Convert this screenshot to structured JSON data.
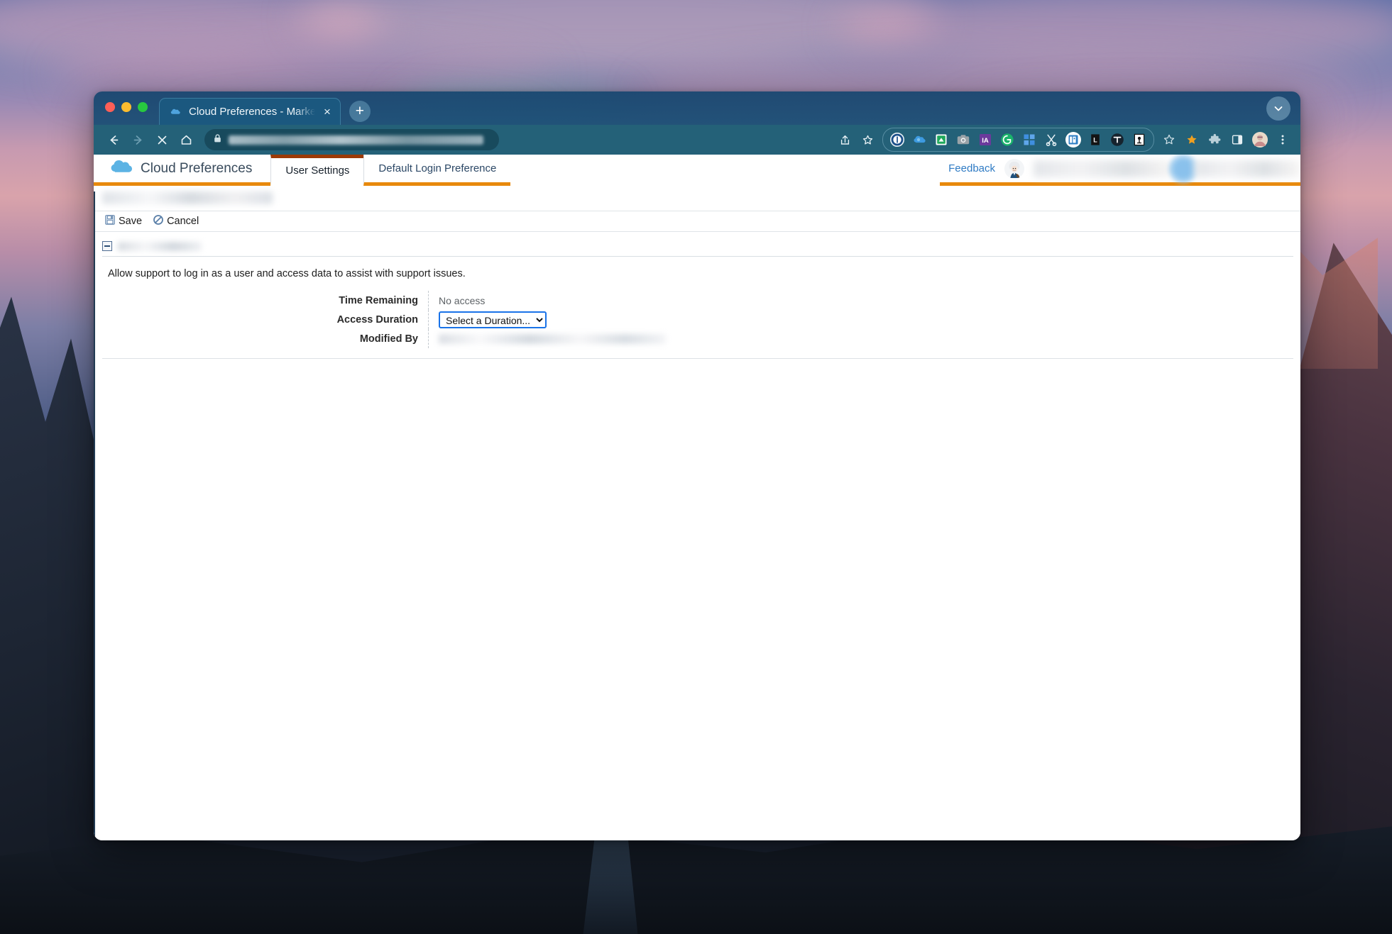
{
  "window": {
    "traffic_lights": [
      "close",
      "minimize",
      "maximize"
    ],
    "tab": {
      "title": "Cloud Preferences - Marketing",
      "favicon": "cloud-favicon",
      "close_label": "×"
    },
    "new_tab_label": "+",
    "tab_list_chevron": "chevron-down-icon"
  },
  "toolbar": {
    "back": "back-arrow",
    "forward": "forward-arrow",
    "stop": "stop-x",
    "home": "home-icon",
    "lock": "lock-icon",
    "url_redacted": true,
    "share": "share-icon",
    "bookmark_star": "star-outline-icon",
    "extensions": [
      {
        "name": "1password-extension",
        "label": "1"
      },
      {
        "name": "cloud-extension",
        "label": ""
      },
      {
        "name": "green-doc-extension",
        "label": ""
      },
      {
        "name": "camera-extension",
        "label": ""
      },
      {
        "name": "ia-extension",
        "label": "IA"
      },
      {
        "name": "grammarly-extension",
        "label": "G"
      },
      {
        "name": "grid-extension",
        "label": ""
      },
      {
        "name": "scissors-extension",
        "label": ""
      },
      {
        "name": "badge-extension",
        "label": ""
      },
      {
        "name": "l-extension",
        "label": "L"
      },
      {
        "name": "t-extension",
        "label": "T"
      },
      {
        "name": "boxed-extension",
        "label": ""
      }
    ],
    "star_outline": "star-outline-icon",
    "star_filled": "star-filled-icon",
    "puzzle": "puzzle-icon",
    "side_panel": "side-panel-icon",
    "profile": "profile-avatar",
    "menu": "three-dot-menu"
  },
  "app": {
    "brand": "Cloud Preferences",
    "brand_icon": "cloud-logo",
    "tabs": [
      {
        "label": "User Settings",
        "active": true
      },
      {
        "label": "Default Login Preference",
        "active": false
      }
    ],
    "feedback_label": "Feedback",
    "einstein_avatar": "einstein-avatar"
  },
  "content": {
    "page_title_redacted": true,
    "actions": [
      {
        "label": "Save",
        "icon": "save-floppy-icon"
      },
      {
        "label": "Cancel",
        "icon": "cancel-circle-slash-icon"
      }
    ],
    "section_title_redacted": true,
    "description": "Allow support to log in as a user and access data to assist with support issues.",
    "fields": [
      {
        "label": "Time Remaining",
        "value": "No access",
        "type": "text"
      },
      {
        "label": "Access Duration",
        "value": "Select a Duration...",
        "type": "select",
        "options": [
          "Select a Duration..."
        ]
      },
      {
        "label": "Modified By",
        "value": "",
        "type": "redacted"
      }
    ]
  },
  "colors": {
    "browser_chrome": "#246178",
    "tabstrip": "#16456e",
    "active_tab": "#1b587f",
    "app_accent_orange": "#e8890c",
    "app_tab_active_top": "#9c3a07",
    "link_blue": "#2f7bc4",
    "select_focus_blue": "#1a73e8",
    "content_left_border": "#233c54"
  }
}
